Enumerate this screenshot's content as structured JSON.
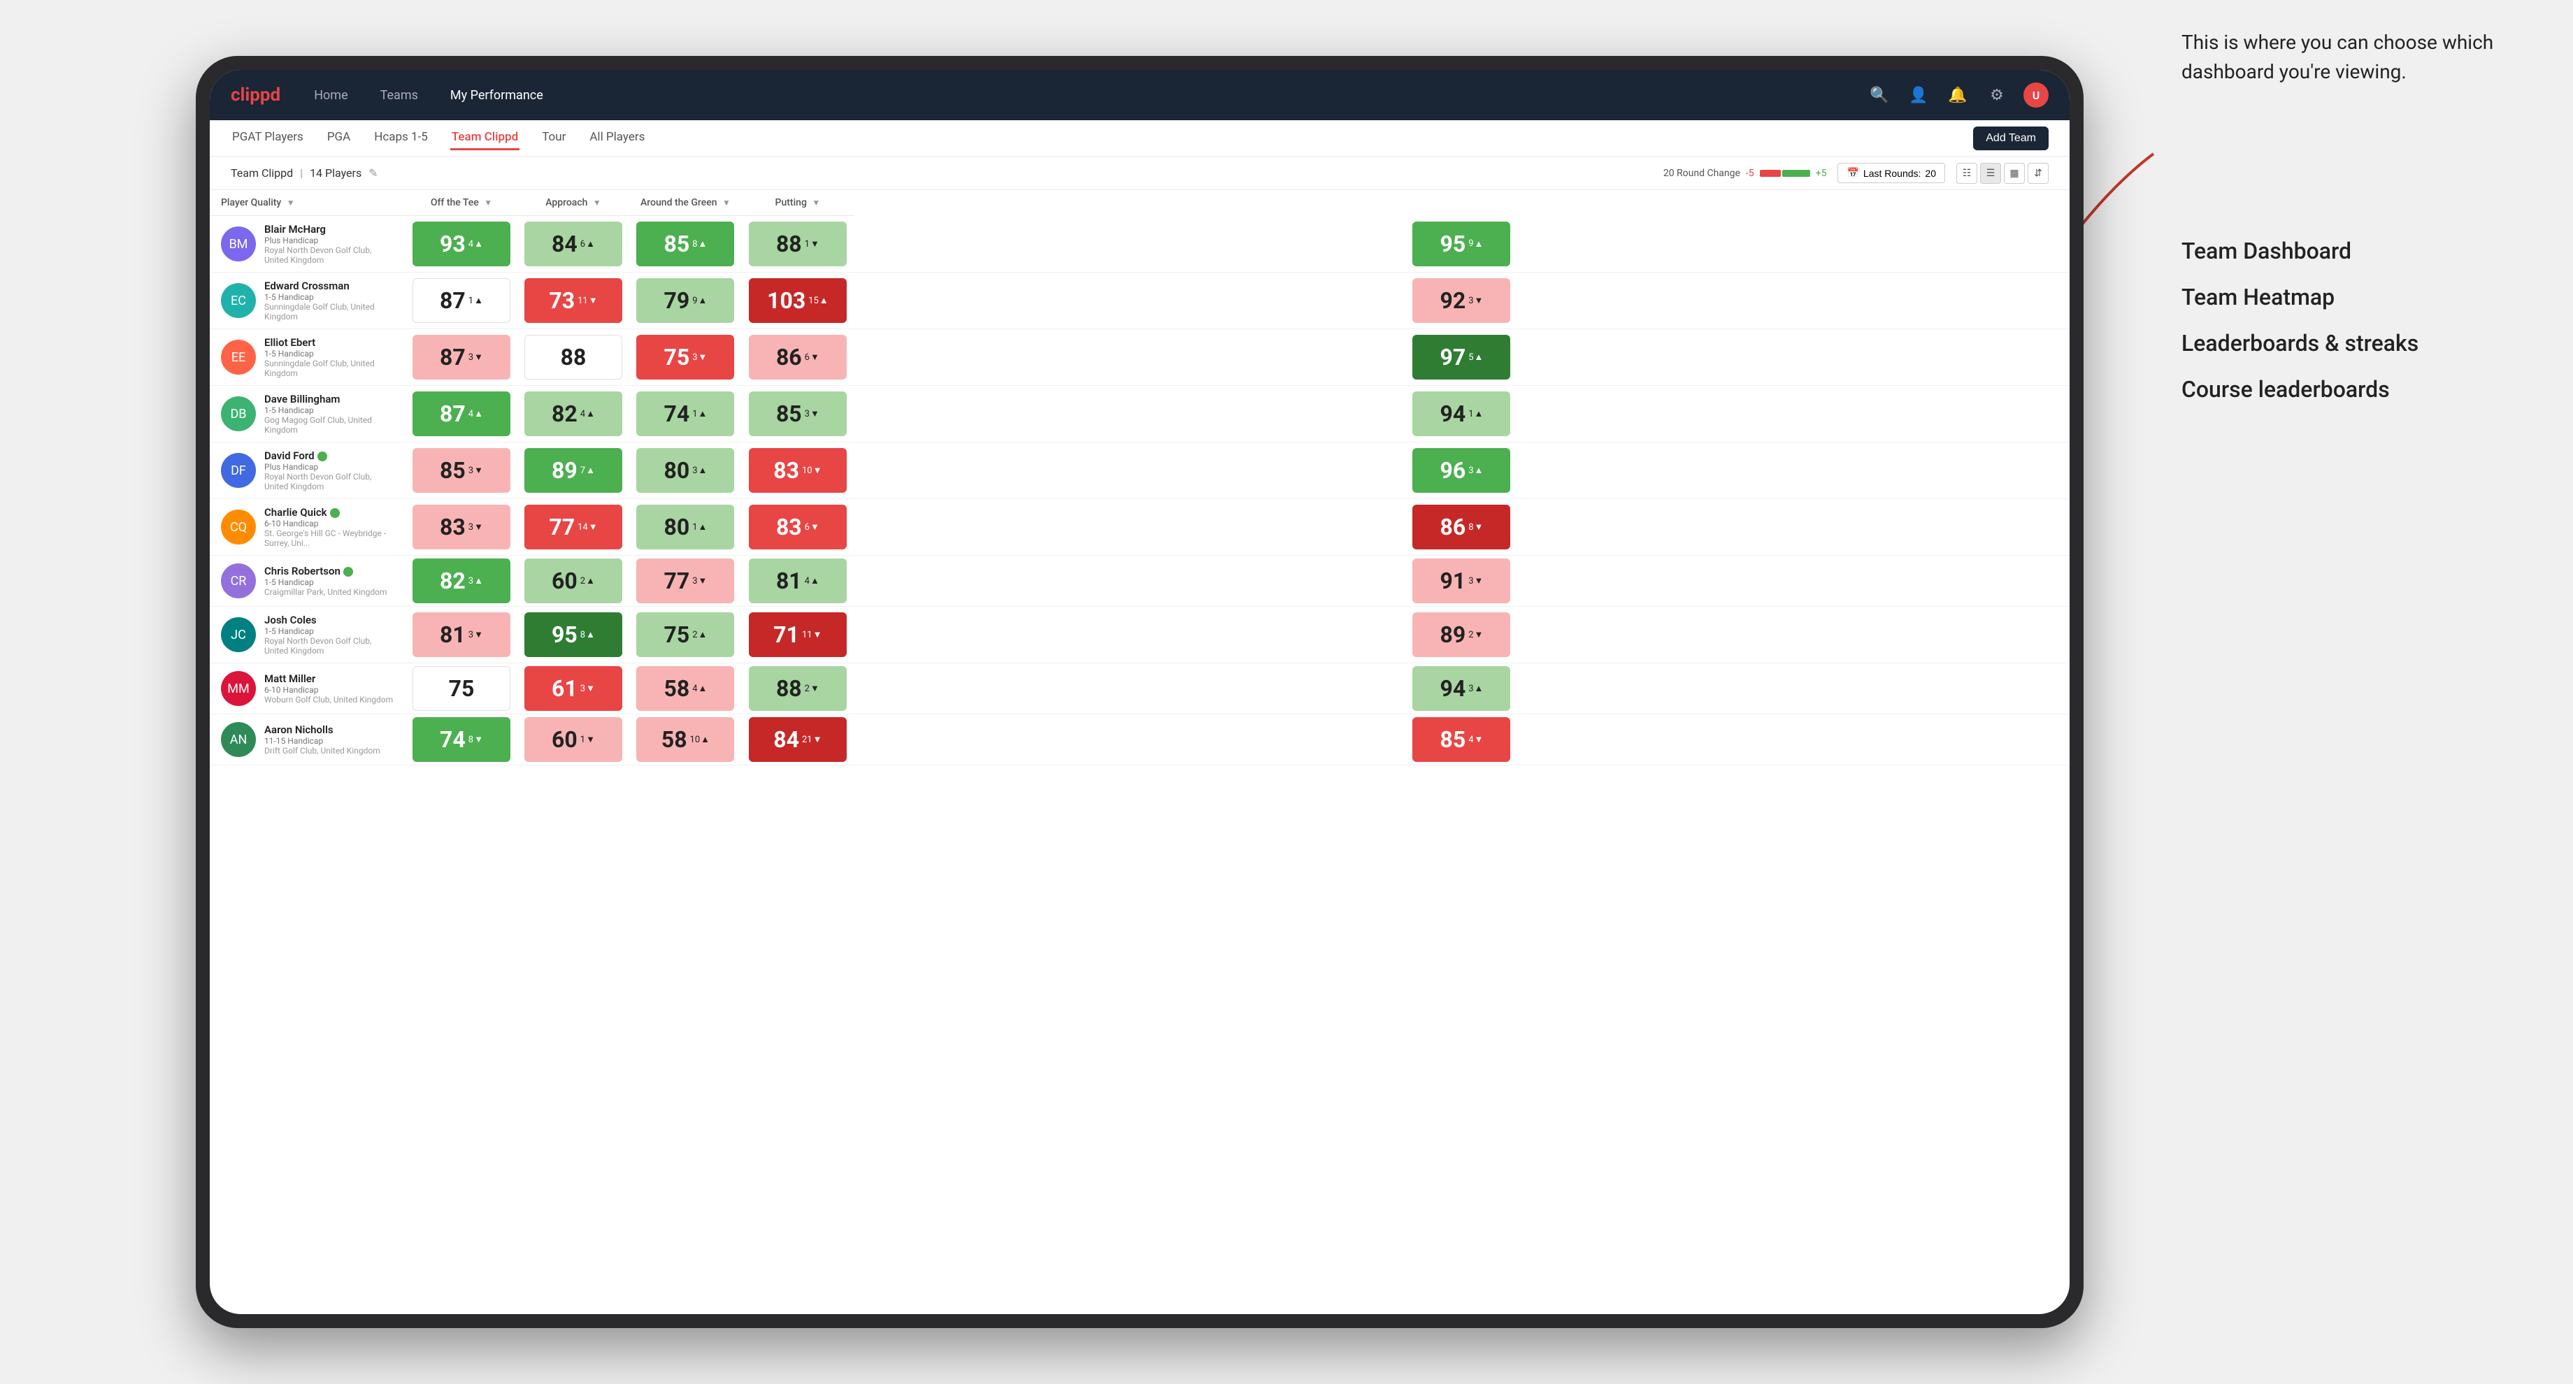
{
  "annotation": {
    "text": "This is where you can choose which dashboard you're viewing.",
    "items": [
      "Team Dashboard",
      "Team Heatmap",
      "Leaderboards & streaks",
      "Course leaderboards"
    ]
  },
  "nav": {
    "logo": "clippd",
    "links": [
      {
        "label": "Home",
        "active": false
      },
      {
        "label": "Teams",
        "active": false
      },
      {
        "label": "My Performance",
        "active": true
      }
    ],
    "icons": [
      "search",
      "person",
      "bell",
      "settings",
      "avatar"
    ]
  },
  "subnav": {
    "links": [
      {
        "label": "PGAT Players",
        "active": false
      },
      {
        "label": "PGA",
        "active": false
      },
      {
        "label": "Hcaps 1-5",
        "active": false
      },
      {
        "label": "Team Clippd",
        "active": true
      },
      {
        "label": "Tour",
        "active": false
      },
      {
        "label": "All Players",
        "active": false
      }
    ],
    "add_team": "Add Team"
  },
  "team_header": {
    "name": "Team Clippd",
    "count": "14 Players",
    "round_change_label": "20 Round Change",
    "change_neg": "-5",
    "change_pos": "+5",
    "last_rounds_label": "Last Rounds:",
    "last_rounds_value": "20"
  },
  "table": {
    "columns": [
      {
        "key": "player",
        "label": "Player Quality",
        "sub": "▼"
      },
      {
        "key": "tee",
        "label": "Off the Tee",
        "sub": "▼"
      },
      {
        "key": "approach",
        "label": "Approach",
        "sub": "▼"
      },
      {
        "key": "around",
        "label": "Around the Green",
        "sub": "▼"
      },
      {
        "key": "putting",
        "label": "Putting",
        "sub": "▼"
      }
    ],
    "rows": [
      {
        "name": "Blair McHarg",
        "hcap": "Plus Handicap",
        "club": "Royal North Devon Golf Club, United Kingdom",
        "verified": false,
        "player_quality": {
          "value": 93,
          "change": 4,
          "dir": "up",
          "color": "green"
        },
        "tee": {
          "value": 84,
          "change": 6,
          "dir": "up",
          "color": "light-green"
        },
        "approach": {
          "value": 85,
          "change": 8,
          "dir": "up",
          "color": "green"
        },
        "around": {
          "value": 88,
          "change": -1,
          "dir": "down",
          "color": "light-green"
        },
        "putting": {
          "value": 95,
          "change": 9,
          "dir": "up",
          "color": "green"
        }
      },
      {
        "name": "Edward Crossman",
        "hcap": "1-5 Handicap",
        "club": "Sunningdale Golf Club, United Kingdom",
        "verified": false,
        "player_quality": {
          "value": 87,
          "change": 1,
          "dir": "up",
          "color": "white"
        },
        "tee": {
          "value": 73,
          "change": -11,
          "dir": "down",
          "color": "red"
        },
        "approach": {
          "value": 79,
          "change": 9,
          "dir": "up",
          "color": "light-green"
        },
        "around": {
          "value": 103,
          "change": 15,
          "dir": "up",
          "color": "dark-red"
        },
        "putting": {
          "value": 92,
          "change": -3,
          "dir": "down",
          "color": "light-red"
        }
      },
      {
        "name": "Elliot Ebert",
        "hcap": "1-5 Handicap",
        "club": "Sunningdale Golf Club, United Kingdom",
        "verified": false,
        "player_quality": {
          "value": 87,
          "change": -3,
          "dir": "down",
          "color": "light-red"
        },
        "tee": {
          "value": 88,
          "change": null,
          "dir": null,
          "color": "white"
        },
        "approach": {
          "value": 75,
          "change": -3,
          "dir": "down",
          "color": "red"
        },
        "around": {
          "value": 86,
          "change": -6,
          "dir": "down",
          "color": "light-red"
        },
        "putting": {
          "value": 97,
          "change": 5,
          "dir": "up",
          "color": "dark-green"
        }
      },
      {
        "name": "Dave Billingham",
        "hcap": "1-5 Handicap",
        "club": "Gog Magog Golf Club, United Kingdom",
        "verified": false,
        "player_quality": {
          "value": 87,
          "change": 4,
          "dir": "up",
          "color": "green"
        },
        "tee": {
          "value": 82,
          "change": 4,
          "dir": "up",
          "color": "light-green"
        },
        "approach": {
          "value": 74,
          "change": 1,
          "dir": "up",
          "color": "light-green"
        },
        "around": {
          "value": 85,
          "change": -3,
          "dir": "down",
          "color": "light-green"
        },
        "putting": {
          "value": 94,
          "change": 1,
          "dir": "up",
          "color": "light-green"
        }
      },
      {
        "name": "David Ford",
        "hcap": "Plus Handicap",
        "club": "Royal North Devon Golf Club, United Kingdom",
        "verified": true,
        "player_quality": {
          "value": 85,
          "change": -3,
          "dir": "down",
          "color": "light-red"
        },
        "tee": {
          "value": 89,
          "change": 7,
          "dir": "up",
          "color": "green"
        },
        "approach": {
          "value": 80,
          "change": 3,
          "dir": "up",
          "color": "light-green"
        },
        "around": {
          "value": 83,
          "change": -10,
          "dir": "down",
          "color": "red"
        },
        "putting": {
          "value": 96,
          "change": 3,
          "dir": "up",
          "color": "green"
        }
      },
      {
        "name": "Charlie Quick",
        "hcap": "6-10 Handicap",
        "club": "St. George's Hill GC - Weybridge - Surrey, Uni...",
        "verified": true,
        "player_quality": {
          "value": 83,
          "change": -3,
          "dir": "down",
          "color": "light-red"
        },
        "tee": {
          "value": 77,
          "change": -14,
          "dir": "down",
          "color": "red"
        },
        "approach": {
          "value": 80,
          "change": 1,
          "dir": "up",
          "color": "light-green"
        },
        "around": {
          "value": 83,
          "change": -6,
          "dir": "down",
          "color": "red"
        },
        "putting": {
          "value": 86,
          "change": -8,
          "dir": "down",
          "color": "dark-red"
        }
      },
      {
        "name": "Chris Robertson",
        "hcap": "1-5 Handicap",
        "club": "Craigmillar Park, United Kingdom",
        "verified": true,
        "player_quality": {
          "value": 82,
          "change": 3,
          "dir": "up",
          "color": "green"
        },
        "tee": {
          "value": 60,
          "change": 2,
          "dir": "up",
          "color": "light-green"
        },
        "approach": {
          "value": 77,
          "change": -3,
          "dir": "down",
          "color": "light-red"
        },
        "around": {
          "value": 81,
          "change": 4,
          "dir": "up",
          "color": "light-green"
        },
        "putting": {
          "value": 91,
          "change": -3,
          "dir": "down",
          "color": "light-red"
        }
      },
      {
        "name": "Josh Coles",
        "hcap": "1-5 Handicap",
        "club": "Royal North Devon Golf Club, United Kingdom",
        "verified": false,
        "player_quality": {
          "value": 81,
          "change": -3,
          "dir": "down",
          "color": "light-red"
        },
        "tee": {
          "value": 95,
          "change": 8,
          "dir": "up",
          "color": "dark-green"
        },
        "approach": {
          "value": 75,
          "change": 2,
          "dir": "up",
          "color": "light-green"
        },
        "around": {
          "value": 71,
          "change": -11,
          "dir": "down",
          "color": "dark-red"
        },
        "putting": {
          "value": 89,
          "change": -2,
          "dir": "down",
          "color": "light-red"
        }
      },
      {
        "name": "Matt Miller",
        "hcap": "6-10 Handicap",
        "club": "Woburn Golf Club, United Kingdom",
        "verified": false,
        "player_quality": {
          "value": 75,
          "change": null,
          "dir": null,
          "color": "white"
        },
        "tee": {
          "value": 61,
          "change": -3,
          "dir": "down",
          "color": "red"
        },
        "approach": {
          "value": 58,
          "change": 4,
          "dir": "up",
          "color": "light-red"
        },
        "around": {
          "value": 88,
          "change": -2,
          "dir": "down",
          "color": "light-green"
        },
        "putting": {
          "value": 94,
          "change": 3,
          "dir": "up",
          "color": "light-green"
        }
      },
      {
        "name": "Aaron Nicholls",
        "hcap": "11-15 Handicap",
        "club": "Drift Golf Club, United Kingdom",
        "verified": false,
        "player_quality": {
          "value": 74,
          "change": -8,
          "dir": "down",
          "color": "green"
        },
        "tee": {
          "value": 60,
          "change": -1,
          "dir": "down",
          "color": "light-red"
        },
        "approach": {
          "value": 58,
          "change": 10,
          "dir": "up",
          "color": "light-red"
        },
        "around": {
          "value": 84,
          "change": -21,
          "dir": "down",
          "color": "dark-red"
        },
        "putting": {
          "value": 85,
          "change": -4,
          "dir": "down",
          "color": "red"
        }
      }
    ]
  }
}
